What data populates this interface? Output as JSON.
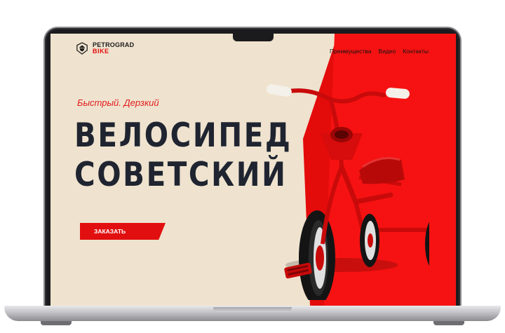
{
  "site": {
    "logo": {
      "line1": "PETROGRAD",
      "line2": "BIKE",
      "icon": "lion-head-icon"
    },
    "nav": [
      "Преимущества",
      "Видео",
      "Контакты"
    ],
    "hero": {
      "tagline": "Быстрый. Дерзкий",
      "headline_line1": "ВЕЛОСИПЕД",
      "headline_line2": "СОВЕТСКИЙ",
      "cta": "ЗАКАЗАТЬ"
    },
    "colors": {
      "accent_red": "#e40b0b",
      "background_beige": "#efe3cf",
      "headline_dark": "#1f2430"
    }
  }
}
